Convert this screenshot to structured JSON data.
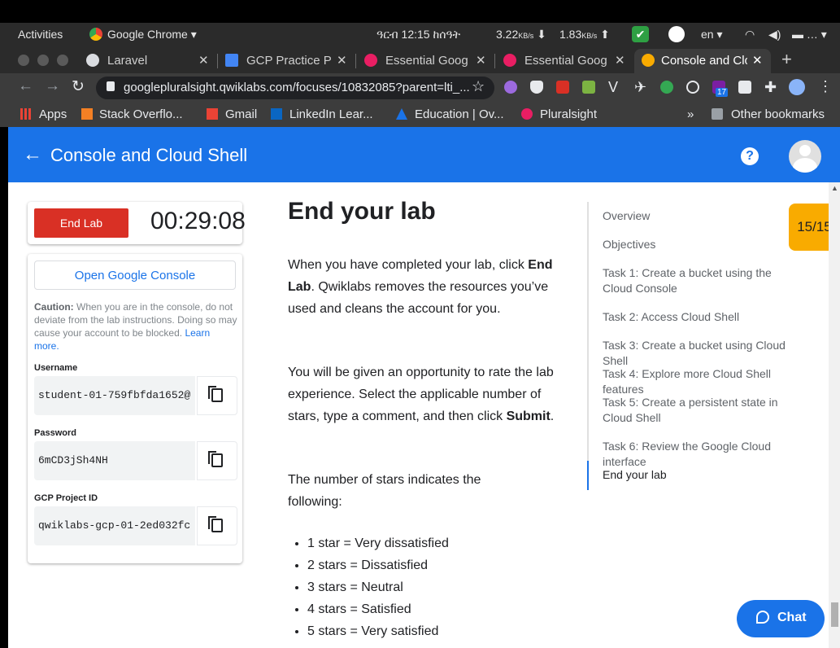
{
  "os": {
    "activities": "Activities",
    "app_name": "Google Chrome",
    "clock": "ዓርብ 12:15 ከሰዓት",
    "net_down": "3.22",
    "net_up": "1.83",
    "net_unit": "KB/s",
    "lang": "en"
  },
  "tabs": [
    {
      "title": "Laravel"
    },
    {
      "title": "GCP Practice Pr"
    },
    {
      "title": "Essential Goog"
    },
    {
      "title": "Essential Goog"
    },
    {
      "title": "Console and Clo"
    }
  ],
  "address": {
    "url": "googlepluralsight.qwiklabs.com/focuses/10832085?parent=lti_..."
  },
  "bookmarks": {
    "items": [
      "Apps",
      "Stack Overflo...",
      "Gmail",
      "LinkedIn Lear...",
      "Education | Ov...",
      "Pluralsight"
    ],
    "more": "»",
    "other": "Other bookmarks"
  },
  "header": {
    "title": "Console and Cloud Shell",
    "help": "?"
  },
  "lab_panel": {
    "end_lab": "End Lab",
    "timer": "00:29:08",
    "open_console": "Open Google Console",
    "caution_label": "Caution:",
    "caution_text": " When you are in the console, do not deviate from the lab instructions. Doing so may cause your account to be blocked. ",
    "learn_more": "Learn more.",
    "username_label": "Username",
    "username_value": "student-01-759fbfda1652@",
    "password_label": "Password",
    "password_value": "6mCD3jSh4NH",
    "project_label": "GCP Project ID",
    "project_value": "qwiklabs-gcp-01-2ed032fc"
  },
  "content": {
    "heading": "End your lab",
    "p1_a": "When you have completed your lab, click ",
    "p1_b": "End Lab",
    "p1_c": ". Qwiklabs removes the resources you’ve used and cleans the account for you.",
    "p2_a": "You will be given an opportunity to rate the lab experience. Select the applicable number of stars, type a comment, and then click ",
    "p2_b": "Submit",
    "p2_c": ".",
    "p3": "The number of stars indicates the following:",
    "stars": [
      "1 star = Very dissatisfied",
      "2 stars = Dissatisfied",
      "3 stars = Neutral",
      "4 stars = Satisfied",
      "5 stars = Very satisfied"
    ]
  },
  "toc": [
    "Overview",
    "Objectives",
    "Task 1: Create a bucket using the Cloud Console",
    "Task 2: Access Cloud Shell",
    "Task 3: Create a bucket using Cloud Shell",
    "Task 4: Explore more Cloud Shell features",
    "Task 5: Create a persistent state in Cloud Shell",
    "Task 6: Review the Google Cloud interface",
    "End your lab"
  ],
  "badge": "15/15",
  "chat": "Chat",
  "ext_badge": "17",
  "colors": {
    "accent": "#1a73e8",
    "danger": "#d93025",
    "badge": "#f9ab00"
  }
}
